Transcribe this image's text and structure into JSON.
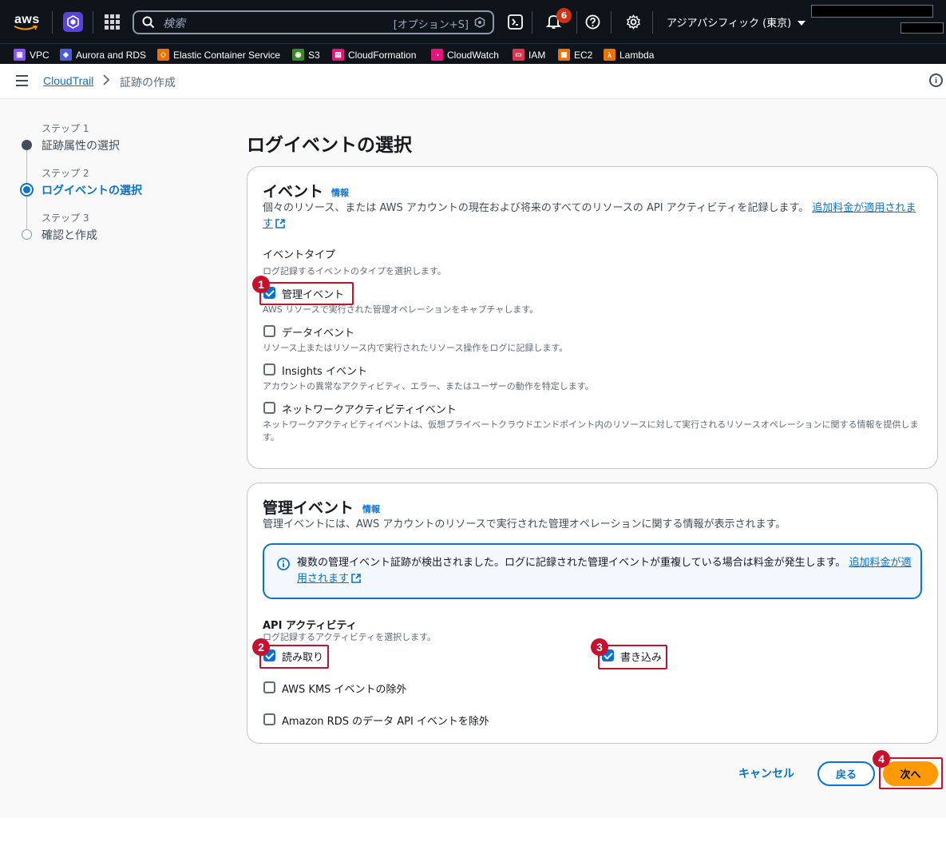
{
  "topnav": {
    "logo_text": "aws",
    "search_placeholder": "検索",
    "search_shortcut": "[オプション+S]",
    "notification_count": "6",
    "region": "アジアパシフィック (東京)",
    "icons": [
      "cube-icon",
      "grid-icon",
      "search-icon",
      "terminal-icon",
      "bell-icon",
      "help-icon",
      "gear-icon",
      "caret-down-icon"
    ]
  },
  "favorites": [
    {
      "label": "VPC",
      "color": "#8c4fff"
    },
    {
      "label": "Aurora and RDS",
      "color": "#4a5bde"
    },
    {
      "label": "Elastic Container Service",
      "color": "#ed7100"
    },
    {
      "label": "S3",
      "color": "#3f8624"
    },
    {
      "label": "CloudFormation",
      "color": "#e7157b"
    },
    {
      "label": "CloudWatch",
      "color": "#e7157b"
    },
    {
      "label": "IAM",
      "color": "#dd344c"
    },
    {
      "label": "EC2",
      "color": "#ed7100"
    },
    {
      "label": "Lambda",
      "color": "#ed7100"
    }
  ],
  "breadcrumb": {
    "service": "CloudTrail",
    "current": "証跡の作成"
  },
  "steps": [
    {
      "num": "ステップ 1",
      "label": "証跡属性の選択",
      "state": "done"
    },
    {
      "num": "ステップ 2",
      "label": "ログイベントの選択",
      "state": "active"
    },
    {
      "num": "ステップ 3",
      "label": "確認と作成",
      "state": "pending"
    }
  ],
  "page_title": "ログイベントの選択",
  "events_card": {
    "title": "イベント",
    "info": "情報",
    "desc_line1": "個々のリソース、または AWS アカウントの現在および将来のすべてのリソースの API アクティビティを記録します。",
    "desc_link_a": "追加料金が適",
    "desc_link_b": "用されます",
    "event_type_label": "イベントタイプ",
    "event_type_desc": "ログ記録するイベントのタイプを選択します。",
    "options": [
      {
        "label": "管理イベント",
        "desc": "AWS リソースで実行された管理オペレーションをキャプチャします。",
        "checked": true
      },
      {
        "label": "データイベント",
        "desc": "リソース上またはリソース内で実行されたリソース操作をログに記録します。",
        "checked": false
      },
      {
        "label": "Insights イベント",
        "desc": "アカウントの異常なアクティビティ、エラー、またはユーザーの動作を特定します。",
        "checked": false
      },
      {
        "label": "ネットワークアクティビティイベント",
        "desc": "ネットワークアクティビティイベントは、仮想プライベートクラウドエンドポイント内のリソースに対して実行されるリソースオペレーションに関する情報を提供します。",
        "checked": false
      }
    ]
  },
  "mgmt_card": {
    "title": "管理イベント",
    "info": "情報",
    "desc": "管理イベントには、AWS アカウントのリソースで実行された管理オペレーションに関する情報が表示されます。",
    "alert_text": "複数の管理イベント証跡が検出されました。ログに記録された管理イベントが重複している場合は料金が発生します。",
    "alert_link_a": "追",
    "alert_link_b": "加料金が適用されます",
    "api_label": "API アクティビティ",
    "api_desc": "ログ記録するアクティビティを選択します。",
    "read": {
      "label": "読み取り",
      "checked": true
    },
    "write": {
      "label": "書き込み",
      "checked": true
    },
    "exclude_kms": {
      "label": "AWS KMS イベントの除外",
      "checked": false
    },
    "exclude_rds": {
      "label": "Amazon RDS のデータ API イベントを除外",
      "checked": false
    }
  },
  "annotations": [
    "1",
    "2",
    "3",
    "4"
  ],
  "buttons": {
    "cancel": "キャンセル",
    "back": "戻る",
    "next": "次へ"
  },
  "colors": {
    "accent": "#0972d3",
    "primary_button": "#ff9900",
    "annotation": "#c6102e",
    "nav_bg": "#0f141a"
  }
}
